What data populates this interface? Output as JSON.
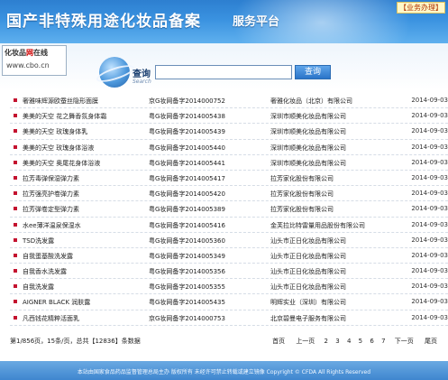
{
  "header": {
    "title": "国产非特殊用途化妆品备案",
    "subtitle": "服务平台",
    "badge": "【业务办理】"
  },
  "logo": {
    "line1_a": "化妆品",
    "line1_b": "网",
    "line1_c": "在线",
    "line2": "www.cbo.cn"
  },
  "band": {
    "slogan": ""
  },
  "search": {
    "label": "查询",
    "sublabel": "Search",
    "value": "",
    "button": "查询"
  },
  "records": [
    {
      "name": "奢雅味辉源欧蚕丝隐形面膜",
      "code": "京G妆网备字2014000752",
      "company": "奢雅化妆品（北京）有限公司",
      "date": "2014-09-03"
    },
    {
      "name": "美美的天空 花之舞香氛身体霜",
      "code": "粤G妆网备字2014005438",
      "company": "深圳市顺美化妆品有限公司",
      "date": "2014-09-03"
    },
    {
      "name": "美美的天空 玫瑰身体乳",
      "code": "粤G妆网备字2014005439",
      "company": "深圳市顺美化妆品有限公司",
      "date": "2014-09-03"
    },
    {
      "name": "美美的天空 玫瑰身体浴液",
      "code": "粤G妆网备字2014005440",
      "company": "深圳市顺美化妆品有限公司",
      "date": "2014-09-03"
    },
    {
      "name": "美美的天空 奥尾花身体浴液",
      "code": "粤G妆网备字2014005441",
      "company": "深圳市顺美化妆品有限公司",
      "date": "2014-09-03"
    },
    {
      "name": "拉芳毒弹保湿弹力素",
      "code": "粤G妆网备字2014005417",
      "company": "拉芳家化股份有限公司",
      "date": "2014-09-03"
    },
    {
      "name": "拉芳强亮护卷弹力素",
      "code": "粤G妆网备字2014005420",
      "company": "拉芳家化股份有限公司",
      "date": "2014-09-03"
    },
    {
      "name": "拉芳弹卷定型弹力素",
      "code": "粤G妆网备字2014005389",
      "company": "拉芳家化股份有限公司",
      "date": "2014-09-03"
    },
    {
      "name": "水ee薄洋温泉保湿水",
      "code": "粤G妆网备字2014005416",
      "company": "金芙拉比特雷量用品股份有限公司",
      "date": "2014-09-03"
    },
    {
      "name": "TSD洗发露",
      "code": "粤G妆网备字2014005360",
      "company": "汕头市正日化妆品有限公司",
      "date": "2014-09-03"
    },
    {
      "name": "自我蛋基酸洗发露",
      "code": "粤G妆网备字2014005349",
      "company": "汕头市正日化妆品有限公司",
      "date": "2014-09-03"
    },
    {
      "name": "自我香水洗发露",
      "code": "粤G妆网备字2014005356",
      "company": "汕头市正日化妆品有限公司",
      "date": "2014-09-03"
    },
    {
      "name": "自我洗发露",
      "code": "粤G妆网备字2014005355",
      "company": "汕头市正日化妆品有限公司",
      "date": "2014-09-03"
    },
    {
      "name": "AIGNER BLACK 润肤露",
      "code": "粤G妆网备字2014005435",
      "company": "明辉实业（深圳）有限公司",
      "date": "2014-09-03"
    },
    {
      "name": "凡西钱花精粹活面乳",
      "code": "京G妆网备字2014000753",
      "company": "北京碧曼电子服务有限公司",
      "date": "2014-09-03"
    }
  ],
  "pagination": {
    "info": "第1/856页，15条/页，总共【12836】条数据",
    "first": "首页",
    "prev": "上一页",
    "pages": [
      "2",
      "3",
      "4",
      "5",
      "6",
      "7"
    ],
    "next": "下一页",
    "last": "尾页"
  },
  "footer": {
    "text": "本站由国家食品药品监督管理总局主办  版权所有  未经许可禁止转载或建立镜像  Copyright © CFDA All Rights Reserved"
  }
}
